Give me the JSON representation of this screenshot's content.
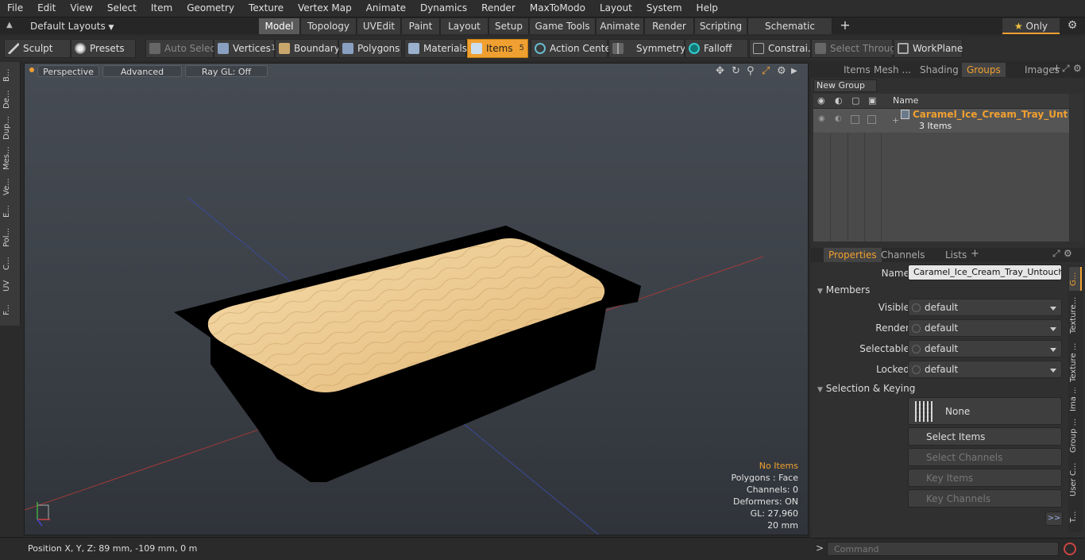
{
  "menubar": {
    "items": [
      "File",
      "Edit",
      "View",
      "Select",
      "Item",
      "Geometry",
      "Texture",
      "Vertex Map",
      "Animate",
      "Dynamics",
      "Render",
      "MaxToModo",
      "Layout",
      "System",
      "Help"
    ]
  },
  "layoutbar": {
    "layouts_label": "Default Layouts",
    "tabs": [
      "Model",
      "Topology",
      "UVEdit",
      "Paint",
      "Layout",
      "Setup",
      "Game Tools",
      "Animate",
      "Render",
      "Scripting",
      "Schematic Fusion"
    ],
    "active_tab": "Model",
    "only_label": "Only"
  },
  "toolbar": {
    "sculpt": "Sculpt",
    "presets": "Presets",
    "auto_select": "Auto Select",
    "vertices": "Vertices",
    "vertices_count": "1",
    "boundary": "Boundary",
    "polygons": "Polygons",
    "materials": "Materials",
    "items": "Items",
    "items_count": "5",
    "action_center": "Action Center",
    "symmetry": "Symmetry",
    "falloff": "Falloff",
    "constraints": "Constrai...",
    "select_through": "Select Through",
    "workplane": "WorkPlane"
  },
  "lefttabs": [
    "B...",
    "De...",
    "Dup...",
    "Mes...",
    "Ve...",
    "E...",
    "Pol...",
    "C...",
    "UV",
    "F..."
  ],
  "viewport": {
    "perspective": "Perspective",
    "advanced": "Advanced",
    "raygl": "Ray GL: Off",
    "hud": {
      "no_items": "No Items",
      "polygons": "Polygons : Face",
      "channels": "Channels: 0",
      "deformers": "Deformers: ON",
      "gl": "GL: 27,960",
      "scale": "20 mm"
    }
  },
  "status": {
    "position": "Position X, Y, Z:  89 mm, -109 mm, 0 m"
  },
  "groups_panel": {
    "tabs": [
      "Items",
      "Mesh ...",
      "Shading",
      "Groups",
      "Images"
    ],
    "active_tab": "Groups",
    "new_group": "New Group",
    "name_header": "Name",
    "group_name": "Caramel_Ice_Cream_Tray_Unto...",
    "group_count": "3 Items"
  },
  "properties": {
    "tabs": [
      "Properties",
      "Channels",
      "Lists"
    ],
    "name_label": "Name",
    "name_value": "Caramel_Ice_Cream_Tray_Untouched",
    "members_label": "Members",
    "visible_label": "Visible",
    "visible_value": "default",
    "render_label": "Render",
    "render_value": "default",
    "selectable_label": "Selectable",
    "selectable_value": "default",
    "locked_label": "Locked",
    "locked_value": "default",
    "selection_label": "Selection & Keying",
    "none_label": "None",
    "select_items": "Select Items",
    "select_channels": "Select Channels",
    "key_items": "Key Items",
    "key_channels": "Key Channels",
    "expand": ">>"
  },
  "right_vtabs": [
    "G...",
    "Texture...",
    "Texture ...",
    "Ima ...",
    "Group ...",
    "User C...",
    "T..."
  ],
  "command": {
    "prompt": ">",
    "placeholder": "Command"
  },
  "colors": {
    "accent": "#f0a030",
    "ice_cream": "#e8c48a",
    "tray": "#000000"
  }
}
